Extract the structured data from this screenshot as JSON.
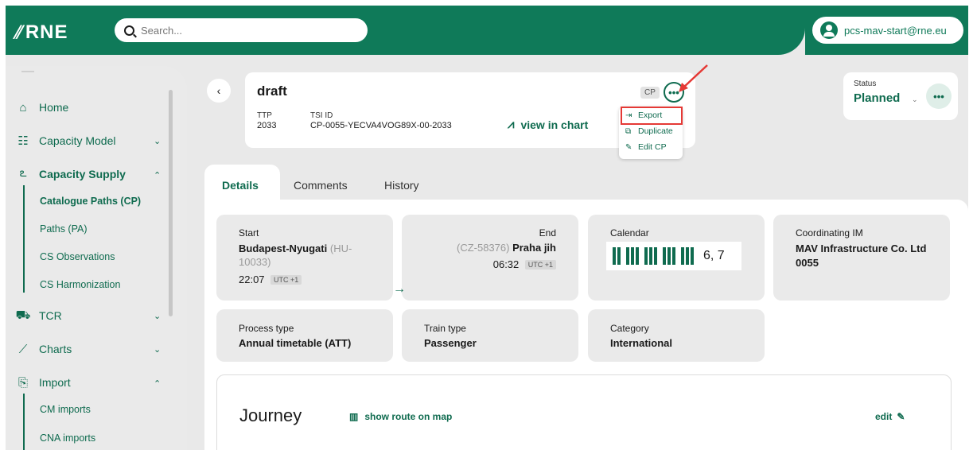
{
  "header": {
    "logo_text": "RNE",
    "search_placeholder": "Search...",
    "user": "pcs-mav-start@rne.eu"
  },
  "sidebar": {
    "home": "Home",
    "capacity_model": "Capacity Model",
    "capacity_supply": "Capacity Supply",
    "sub_cs": [
      "Catalogue Paths (CP)",
      "Paths (PA)",
      "CS Observations",
      "CS Harmonization"
    ],
    "tcr": "TCR",
    "charts": "Charts",
    "import": "Import",
    "sub_import": [
      "CM imports",
      "CNA imports"
    ]
  },
  "cp": {
    "title": "draft",
    "badge": "CP",
    "ttp_label": "TTP",
    "ttp_value": "2033",
    "tsi_label": "TSI ID",
    "tsi_value": "CP-0055-YECVA4VOG89X-00-2033",
    "view_chart": "view in chart"
  },
  "menu": {
    "items": [
      "Export",
      "Duplicate",
      "Edit CP"
    ]
  },
  "status": {
    "label": "Status",
    "value": "Planned"
  },
  "tabs": [
    "Details",
    "Comments",
    "History"
  ],
  "details": {
    "start": {
      "label": "Start",
      "station": "Budapest-Nyugati",
      "code": "(HU-10033)",
      "time": "22:07",
      "utc": "UTC +1"
    },
    "end": {
      "label": "End",
      "code": "(CZ-58376)",
      "station": "Praha jih",
      "time": "06:32",
      "utc": "UTC +1"
    },
    "calendar": {
      "label": "Calendar",
      "days": "6, 7"
    },
    "coordinating_im": {
      "label": "Coordinating IM",
      "value": "MAV Infrastructure Co. Ltd 0055"
    },
    "process_type": {
      "label": "Process type",
      "value": "Annual timetable (ATT)"
    },
    "train_type": {
      "label": "Train type",
      "value": "Passenger"
    },
    "category": {
      "label": "Category",
      "value": "International"
    }
  },
  "journey": {
    "title": "Journey",
    "route_link": "show route on map",
    "edit": "edit"
  },
  "colors": {
    "brand": "#0f7a59",
    "highlight": "#e53935"
  }
}
